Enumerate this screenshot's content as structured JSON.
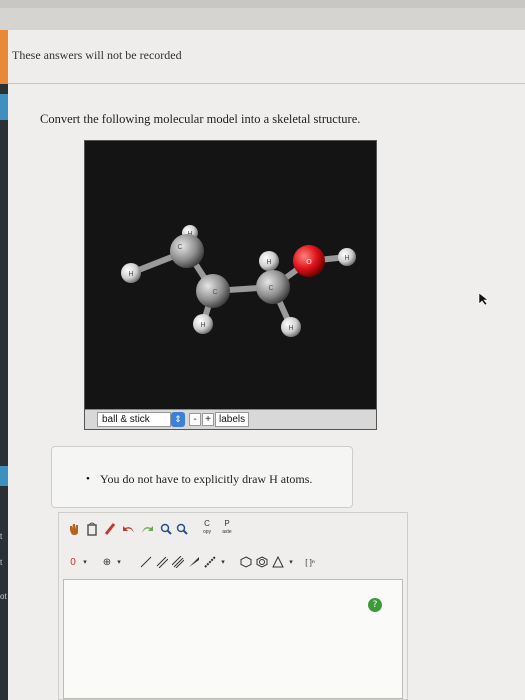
{
  "banner": {
    "text": "These answers will not be recorded"
  },
  "question": {
    "text": "Convert the following molecular model into a skeletal structure."
  },
  "viewer": {
    "render_mode": "ball & stick",
    "minus_label": "-",
    "plus_label": "+",
    "labels_button": "labels",
    "atoms": {
      "carbon": "C",
      "hydrogen": "H",
      "oxygen": "O"
    }
  },
  "hint": {
    "text": "You do not have to explicitly draw H atoms."
  },
  "editor": {
    "copy_label": "C",
    "copy_sub": "opy",
    "paste_label": "P",
    "paste_sub": "aste",
    "charge_label": "0",
    "bracket_label": "[ ]ⁿ",
    "check_icon": "?"
  },
  "sidebar": {
    "labels": [
      "t",
      "t",
      "ot"
    ]
  },
  "colors": {
    "accent": "#e8893a",
    "oxygen": "#e0141a",
    "carbon": "#8e8e8e",
    "hydrogen": "#d8d8d8"
  }
}
